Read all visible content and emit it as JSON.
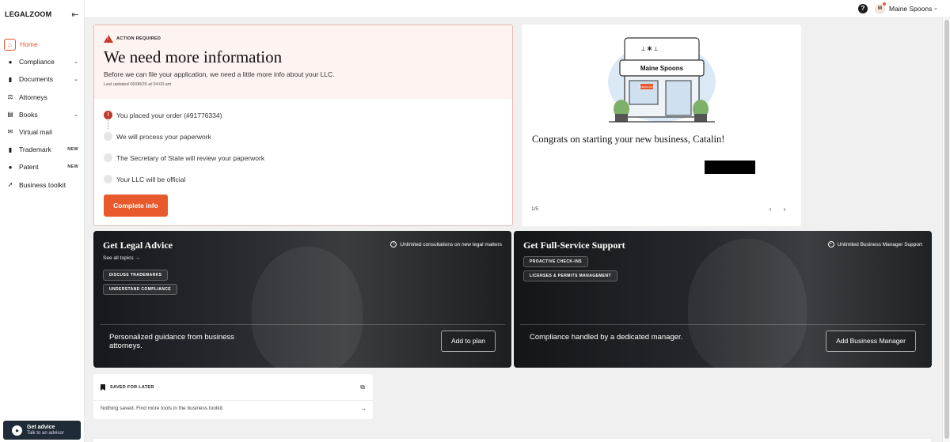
{
  "brand": {
    "logo": "LEGALZOOM",
    "accent": "#e85a2c"
  },
  "sidebar": {
    "items": [
      {
        "label": "Home",
        "icon": "home-icon",
        "active": true
      },
      {
        "label": "Compliance",
        "icon": "shield-icon",
        "chevron": true
      },
      {
        "label": "Documents",
        "icon": "document-icon",
        "chevron": true
      },
      {
        "label": "Attorneys",
        "icon": "attorney-icon"
      },
      {
        "label": "Books",
        "icon": "book-icon",
        "chevron": true
      },
      {
        "label": "Virtual mail",
        "icon": "mail-icon"
      },
      {
        "label": "Trademark",
        "icon": "trademark-icon",
        "badge": "NEW"
      },
      {
        "label": "Patent",
        "icon": "patent-icon",
        "badge": "NEW"
      },
      {
        "label": "Business toolkit",
        "icon": "rocket-icon"
      }
    ],
    "advice": {
      "title": "Get advice",
      "subtitle": "Talk to an advisor"
    }
  },
  "topbar": {
    "user_initial": "M",
    "user_name": "Maine Spoons"
  },
  "action": {
    "label": "ACTION REQUIRED",
    "title": "We need more information",
    "description": "Before we can file your application, we need a little more info about your LLC.",
    "updated": "Last updated 06/08/26 at 04:03 am",
    "steps": [
      "You placed your order (#91776334)",
      "We will process your paperwork",
      "The Secretary of State will review your paperwork",
      "Your LLC will be official"
    ],
    "button": "Complete info"
  },
  "congrats": {
    "store_name": "Maine Spoons",
    "sign": "OPENING SOON",
    "message": "Congrats on starting your new business, Catalin!",
    "pager": "1/5"
  },
  "legal_advice": {
    "title": "Get Legal Advice",
    "tag": "Unlimited consultations on new legal matters",
    "see_all": "See all topics",
    "chips": [
      "DISCUSS TRADEMARKS",
      "UNDERSTAND COMPLIANCE"
    ],
    "description": "Personalized guidance from business attorneys.",
    "button": "Add to plan"
  },
  "full_service": {
    "title": "Get Full-Service Support",
    "tag": "Unlimited Business Manager Support",
    "chips": [
      "PROACTIVE CHECK-INS",
      "LICENSES & PERMITS MANAGEMENT"
    ],
    "description": "Compliance handled by a dedicated manager.",
    "button": "Add Business Manager"
  },
  "saved": {
    "label": "SAVED FOR LATER",
    "empty": "Nothing saved. Find more tools in the business toolkit."
  }
}
